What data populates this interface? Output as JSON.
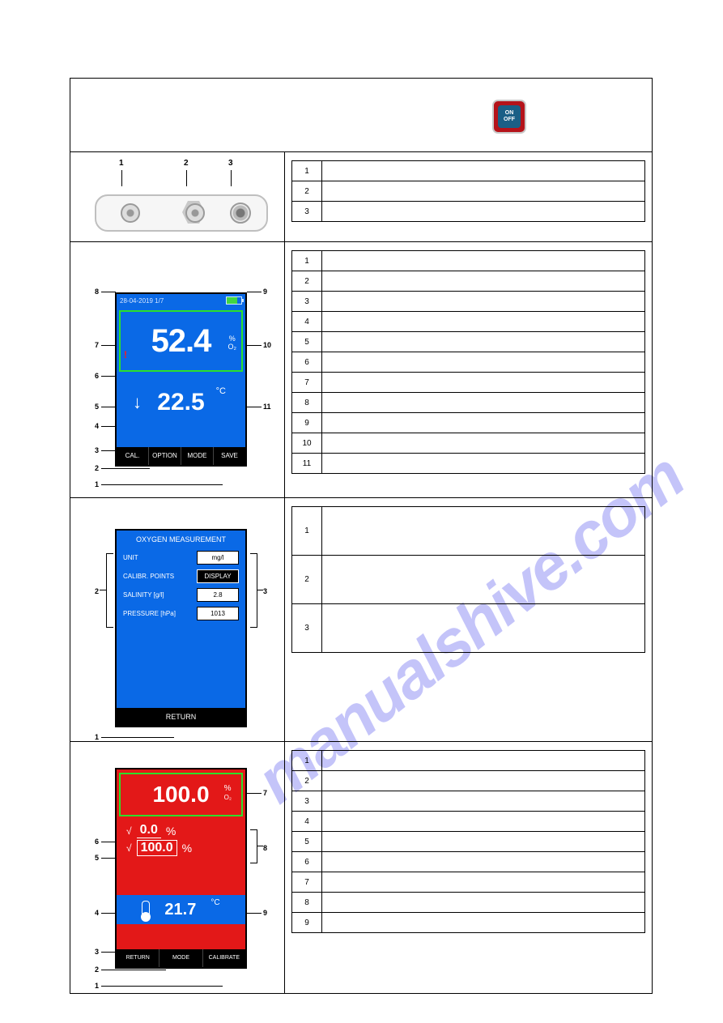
{
  "header": {
    "button_top": "ON",
    "button_bottom": "OFF"
  },
  "row1": {
    "labels": {
      "c1": "1",
      "c2": "2",
      "c3": "3"
    },
    "table": [
      {
        "n": "1",
        "desc": ""
      },
      {
        "n": "2",
        "desc": ""
      },
      {
        "n": "3",
        "desc": ""
      }
    ]
  },
  "row2": {
    "status_date": "28-04-2019   1/7",
    "main_value": "52.4",
    "main_unit_top": "%",
    "main_unit_bottom": "O₂",
    "sub_arrow": "↓",
    "sub_value": "22.5",
    "sub_unit": "°C",
    "buttons": {
      "cal": "CAL.",
      "option": "OPTION",
      "mode": "MODE",
      "save": "SAVE"
    },
    "leads": {
      "l1": "1",
      "l2": "2",
      "l3": "3",
      "l4": "4",
      "l5": "5",
      "l6": "6",
      "l7": "7",
      "l8": "8",
      "l9": "9",
      "l10": "10",
      "l11": "11"
    },
    "table": [
      {
        "n": "1",
        "desc": ""
      },
      {
        "n": "2",
        "desc": ""
      },
      {
        "n": "3",
        "desc": ""
      },
      {
        "n": "4",
        "desc": ""
      },
      {
        "n": "5",
        "desc": ""
      },
      {
        "n": "6",
        "desc": ""
      },
      {
        "n": "7",
        "desc": ""
      },
      {
        "n": "8",
        "desc": ""
      },
      {
        "n": "9",
        "desc": ""
      },
      {
        "n": "10",
        "desc": ""
      },
      {
        "n": "11",
        "desc": ""
      }
    ]
  },
  "row3": {
    "title": "OXYGEN MEASUREMENT",
    "lines": {
      "unit_lbl": "UNIT",
      "unit_val": "mg/l",
      "cal_lbl": "CALIBR. POINTS",
      "cal_val": "DISPLAY",
      "sal_lbl": "SALINITY  [g/l]",
      "sal_val": "2.8",
      "pres_lbl": "PRESSURE  [hPa]",
      "pres_val": "1013"
    },
    "return": "RETURN",
    "leads": {
      "l1": "1",
      "l2": "2",
      "l3": "3"
    },
    "table": [
      {
        "n": "1",
        "desc": ""
      },
      {
        "n": "2",
        "desc": ""
      },
      {
        "n": "3",
        "desc": ""
      }
    ]
  },
  "row4": {
    "top_value": "100.0",
    "top_unit_pct": "%",
    "top_unit_o2": "O₂",
    "line1_check": "√",
    "line1_val": "0.0",
    "line1_unit": "%",
    "line2_check": "√",
    "line2_val": "100.0",
    "line2_unit": "%",
    "temp_val": "21.7",
    "temp_unit": "°C",
    "buttons": {
      "return": "RETURN",
      "mode": "MODE",
      "calibrate": "CALIBRATE"
    },
    "leads": {
      "l1": "1",
      "l2": "2",
      "l3": "3",
      "l4": "4",
      "l5": "5",
      "l6": "6",
      "l7": "7",
      "l8": "8",
      "l9": "9"
    },
    "table": [
      {
        "n": "1",
        "desc": ""
      },
      {
        "n": "2",
        "desc": ""
      },
      {
        "n": "3",
        "desc": ""
      },
      {
        "n": "4",
        "desc": ""
      },
      {
        "n": "5",
        "desc": ""
      },
      {
        "n": "6",
        "desc": ""
      },
      {
        "n": "7",
        "desc": ""
      },
      {
        "n": "8",
        "desc": ""
      },
      {
        "n": "9",
        "desc": ""
      }
    ]
  },
  "watermark": "manualshive.com"
}
